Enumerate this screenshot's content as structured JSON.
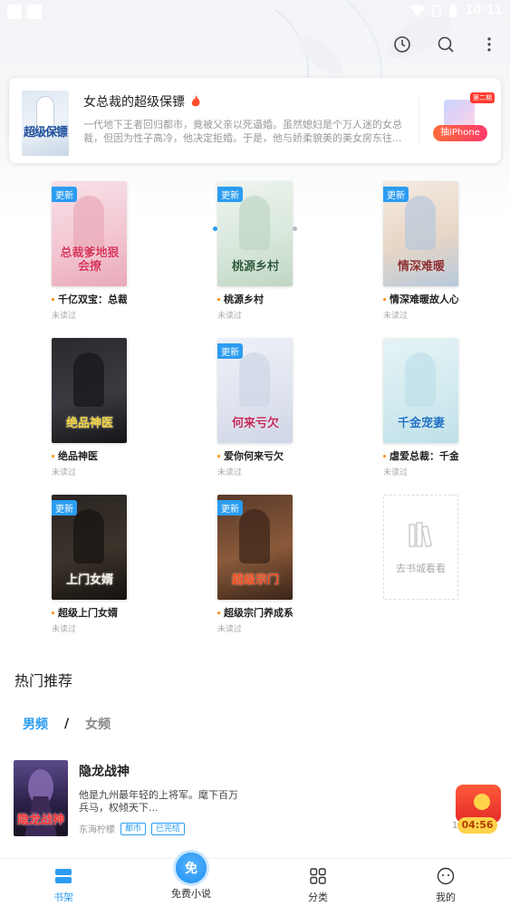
{
  "status_bar": {
    "time": "10:11"
  },
  "toolbar": {
    "icons": [
      "history-icon",
      "search-icon",
      "more-icon"
    ]
  },
  "banner": {
    "title": "女总裁的超级保镖",
    "description": "一代地下王者回归都市，竟被父亲以死逼婚。虽然媳妇是个万人迷的女总裁，但因为性子高冷，他决定拒婚。于是，他与娇柔貌美的美女房东往...",
    "cover_text": "超级保镖",
    "promo_tag": "第二期",
    "promo_button": "抽iPhone",
    "dots_total": 9,
    "dots_active": 0
  },
  "books": [
    {
      "title": "千亿双宝：总裁爹地狠会撩",
      "status": "未读过",
      "badge": "更新",
      "cover_text": "总裁爹地狠会撩"
    },
    {
      "title": "桃源乡村",
      "status": "未读过",
      "badge": "更新",
      "cover_text": "桃源乡村"
    },
    {
      "title": "情深难暖故人心",
      "status": "未读过",
      "badge": "更新",
      "cover_text": "情深难暖"
    },
    {
      "title": "绝品神医",
      "status": "未读过",
      "badge": "",
      "cover_text": "绝品神医"
    },
    {
      "title": "爱你何来亏欠",
      "status": "未读过",
      "badge": "更新",
      "cover_text": "何来亏欠"
    },
    {
      "title": "虐爱总裁：千金宠妻",
      "status": "未读过",
      "badge": "",
      "cover_text": "千金宠妻"
    },
    {
      "title": "超级上门女婿",
      "status": "未读过",
      "badge": "更新",
      "cover_text": "上门女婿"
    },
    {
      "title": "超级宗门养成系统",
      "status": "未读过",
      "badge": "更新",
      "cover_text": "超级宗门"
    }
  ],
  "add_book": {
    "label": "去书城看看"
  },
  "hot": {
    "title": "热门推荐",
    "tab_male": "男频",
    "tab_sep": "/",
    "tab_female": "女频"
  },
  "recommend": {
    "name": "隐龙战神",
    "description": "他是九州最年轻的上将军。麾下百万兵马，权倾天下...",
    "author": "东海柠檬",
    "tags": [
      "都市",
      "已完结"
    ],
    "cover_text": "隐龙战神"
  },
  "redpack": {
    "timer": "04:56",
    "count": "1"
  },
  "nav": {
    "items": [
      {
        "label": "书架",
        "icon": "bookshelf-icon"
      },
      {
        "label": "免费小说",
        "icon": "free-novel-icon",
        "center_char": "免"
      },
      {
        "label": "分类",
        "icon": "category-grid-icon"
      },
      {
        "label": "我的",
        "icon": "profile-icon"
      }
    ]
  },
  "colors": {
    "accent": "#2b9cf0",
    "badge": "#2b9cf0",
    "fire": "#ff4d2d",
    "promo": "#ff3b30"
  }
}
